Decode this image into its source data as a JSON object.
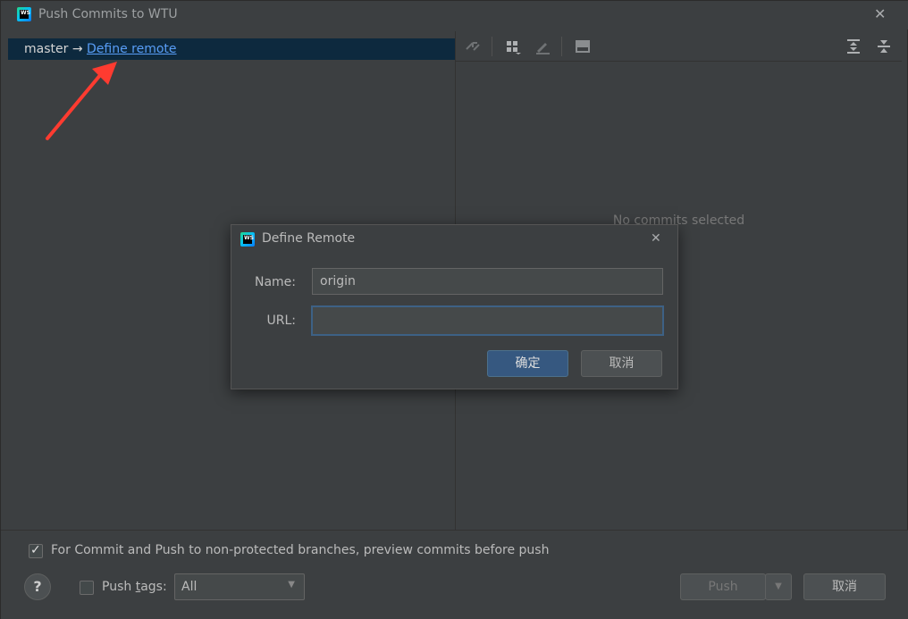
{
  "window": {
    "title": "Push Commits to WTU",
    "app_icon": "webstorm-icon",
    "app_icon_text": "WS"
  },
  "left_pane": {
    "branch": "master",
    "arrow": "→",
    "define_remote_label": "Define remote"
  },
  "right_pane": {
    "toolbar_icons": [
      "cherry-pick-icon",
      "group-by-icon",
      "edit-icon",
      "preview-icon",
      "expand-all-icon",
      "collapse-all-icon"
    ],
    "empty_text": "No commits selected"
  },
  "bottom": {
    "preview_checkbox_checked": true,
    "preview_label": "For Commit and Push to non-protected branches, preview commits before push",
    "help_label": "?",
    "push_tags_checked": false,
    "push_tags_label_prefix": "Push ",
    "push_tags_label_mnemonic": "t",
    "push_tags_label_suffix": "ags:",
    "tags_select_value": "All",
    "push_button": "Push",
    "cancel_button": "取消"
  },
  "dialog": {
    "title": "Define Remote",
    "name_label": "Name:",
    "name_value": "origin",
    "url_label": "URL:",
    "url_value": "",
    "ok_button": "确定",
    "cancel_button": "取消"
  },
  "colors": {
    "selection": "#0d293e",
    "link": "#589df6",
    "primary_button": "#365880",
    "annotation_arrow": "#ff3b30"
  }
}
